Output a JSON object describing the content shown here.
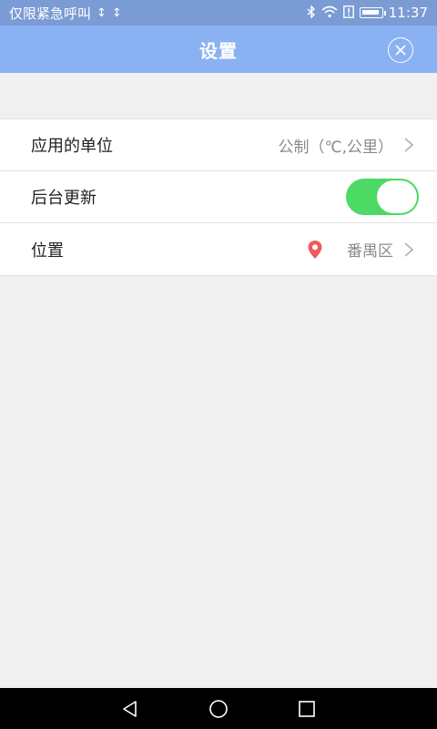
{
  "status_bar": {
    "carrier_text": "仅限紧急呼叫",
    "usb_icons": [
      "usb-icon",
      "usb-icon"
    ],
    "right_icons": [
      "bluetooth-icon",
      "wifi-icon",
      "alert-icon",
      "battery-icon"
    ],
    "time": "11:37"
  },
  "header": {
    "title": "设置",
    "close_icon": "close-circle-icon",
    "background": "#8ab2f2"
  },
  "settings": [
    {
      "label": "应用的单位",
      "value": "公制（℃,公里）",
      "chevron": "chevron-right-icon"
    },
    {
      "label": "后台更新",
      "toggle_on": true,
      "toggle_color": "#4cd964"
    },
    {
      "label": "位置",
      "value": "番禺区",
      "pin_icon": "location-pin-icon",
      "pin_color": "#f05a5a",
      "chevron": "chevron-right-icon"
    }
  ],
  "nav_bar": {
    "buttons": [
      "back-icon",
      "home-icon",
      "recents-icon"
    ]
  }
}
